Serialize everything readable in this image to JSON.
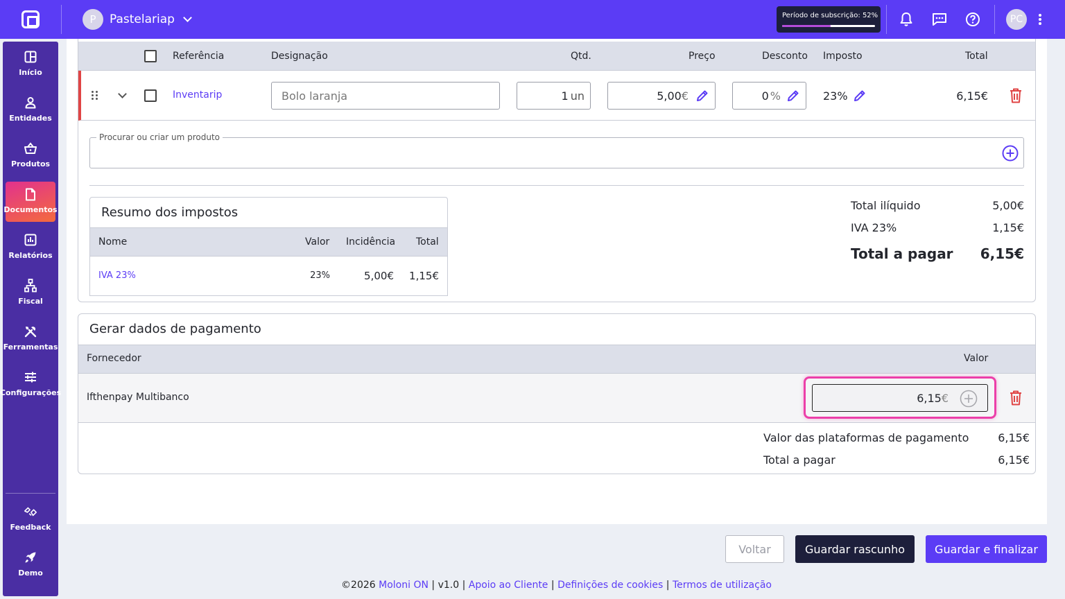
{
  "topbar": {
    "company_initial": "P",
    "company_name": "Pastelariap",
    "subscription_label": "Período de subscrição: 52%",
    "subscription_progress": 0.52,
    "user_initials": "PC"
  },
  "sidebar": {
    "items": [
      {
        "label": "Início",
        "icon": "dashboard-icon"
      },
      {
        "label": "Entidades",
        "icon": "person-icon"
      },
      {
        "label": "Produtos",
        "icon": "basket-icon"
      },
      {
        "label": "Documentos",
        "icon": "document-icon",
        "active": true
      },
      {
        "label": "Relatórios",
        "icon": "chart-icon"
      },
      {
        "label": "Fiscal",
        "icon": "hierarchy-icon"
      },
      {
        "label": "Ferramentas",
        "icon": "tools-icon"
      },
      {
        "label": "Configurações",
        "icon": "sliders-icon"
      }
    ],
    "bottom": [
      {
        "label": "Feedback",
        "icon": "feedback-icon"
      },
      {
        "label": "Demo",
        "icon": "rocket-icon"
      }
    ]
  },
  "products": {
    "headers": {
      "reference": "Referência",
      "designation": "Designação",
      "qty": "Qtd.",
      "price": "Preço",
      "discount": "Desconto",
      "tax": "Imposto",
      "total": "Total"
    },
    "line": {
      "reference": "Inventarip",
      "designation": "Bolo laranja",
      "qty": "1",
      "unit": "un",
      "price": "5,00",
      "currency": "€",
      "discount": "0",
      "discount_unit": "%",
      "tax": "23%",
      "total": "6,15€"
    },
    "search_label": "Procurar ou criar um produto"
  },
  "tax_summary": {
    "title": "Resumo dos impostos",
    "headers": {
      "name": "Nome",
      "value": "Valor",
      "incidence": "Incidência",
      "total": "Total"
    },
    "rows": [
      {
        "name": "IVA 23%",
        "value": "23%",
        "incidence": "5,00€",
        "total": "1,15€"
      }
    ]
  },
  "totals": {
    "net_label": "Total ilíquido",
    "net_value": "5,00€",
    "vat_label": "IVA 23%",
    "vat_value": "1,15€",
    "pay_label": "Total a pagar",
    "pay_value": "6,15€"
  },
  "payment": {
    "title": "Gerar dados de pagamento",
    "headers": {
      "provider": "Fornecedor",
      "value": "Valor"
    },
    "rows": [
      {
        "provider": "Ifthenpay Multibanco",
        "value": "6,15",
        "currency": "€"
      }
    ],
    "platforms_label": "Valor das plataformas de pagamento",
    "platforms_value": "6,15€",
    "total_label": "Total a pagar",
    "total_value": "6,15€"
  },
  "actions": {
    "back": "Voltar",
    "save_draft": "Guardar rascunho",
    "save_finalize": "Guardar e finalizar"
  },
  "footer": {
    "copyright": "©2026",
    "brand": "Moloni ON",
    "version": "v1.0",
    "support": "Apoio ao Cliente",
    "cookies": "Definições de cookies",
    "terms": "Termos de utilização",
    "separator": "|"
  },
  "colors": {
    "primary": "#5b3cf5",
    "sidebar": "#4a2ea3",
    "danger": "#e04545",
    "highlight": "#ec3fa9",
    "dark_button": "#1d1f3b"
  }
}
